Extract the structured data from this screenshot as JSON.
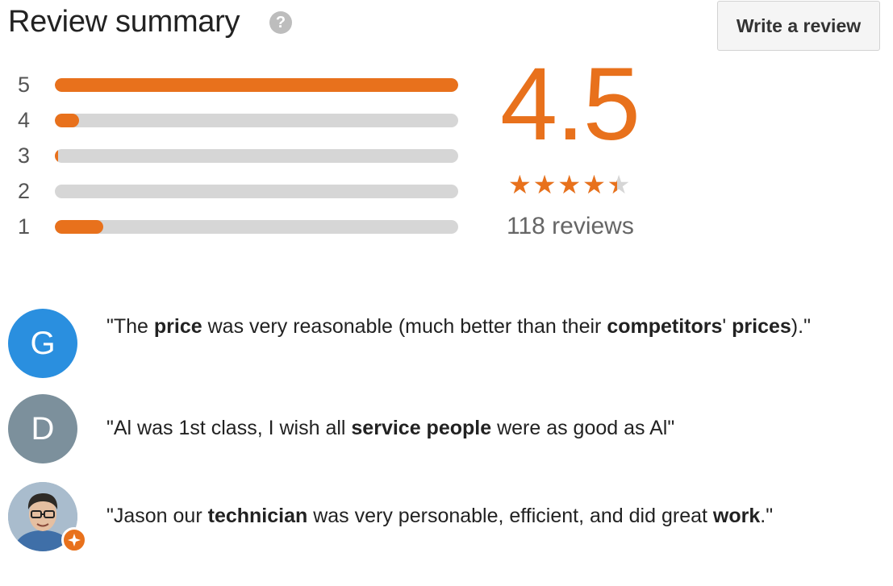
{
  "header": {
    "title": "Review summary",
    "help_icon": "question-circle-icon",
    "write_review_label": "Write a review"
  },
  "distribution": [
    {
      "label": "5",
      "fraction": 1.0
    },
    {
      "label": "4",
      "fraction": 0.06
    },
    {
      "label": "3",
      "fraction": 0.005
    },
    {
      "label": "2",
      "fraction": 0.0
    },
    {
      "label": "1",
      "fraction": 0.12
    }
  ],
  "summary": {
    "average": "4.5",
    "stars_value": 4.5,
    "stars_max": 5,
    "review_count": "118 reviews"
  },
  "colors": {
    "accent": "#e8711c",
    "track": "#d6d6d6",
    "avatar_g": "#2a8fdf",
    "avatar_d": "#7c909c"
  },
  "reviews": [
    {
      "avatar_letter": "G",
      "parts": [
        {
          "text": "\"The ",
          "bold": false
        },
        {
          "text": "price",
          "bold": true
        },
        {
          "text": " was very reasonable (much better than their ",
          "bold": false
        },
        {
          "text": "competitors",
          "bold": true
        },
        {
          "text": "' ",
          "bold": false
        },
        {
          "text": "prices",
          "bold": true
        },
        {
          "text": ").\"",
          "bold": false
        }
      ]
    },
    {
      "avatar_letter": "D",
      "parts": [
        {
          "text": "\"Al was 1st class, I wish all ",
          "bold": false
        },
        {
          "text": "service people",
          "bold": true
        },
        {
          "text": " were as good as Al\"",
          "bold": false
        }
      ]
    },
    {
      "avatar_letter": "",
      "avatar_badge": "local-guide-badge-icon",
      "parts": [
        {
          "text": "\"Jason our ",
          "bold": false
        },
        {
          "text": "technician",
          "bold": true
        },
        {
          "text": " was very personable, efficient, and did great ",
          "bold": false
        },
        {
          "text": "work",
          "bold": true
        },
        {
          "text": ".\"",
          "bold": false
        }
      ]
    }
  ]
}
